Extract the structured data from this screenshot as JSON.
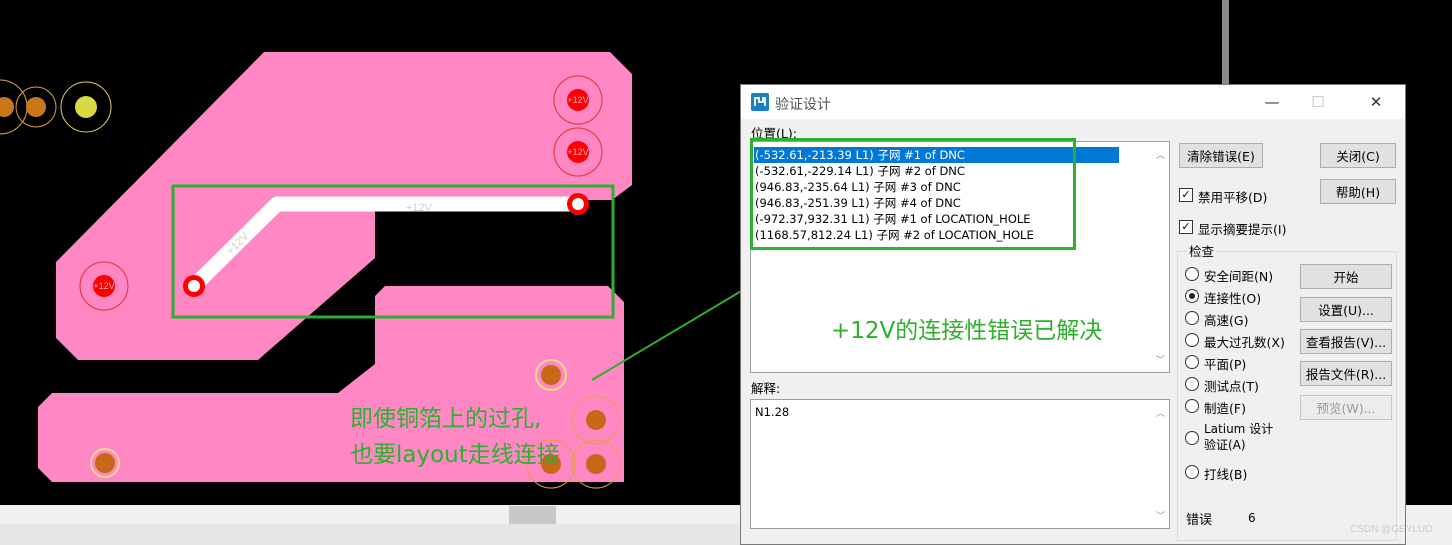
{
  "pcb": {
    "net_labels": [
      "+12V",
      "+12V",
      "+12V",
      "+12V",
      "+12V"
    ]
  },
  "dialog": {
    "title": "验证设计",
    "window_controls": {
      "minimize": "—",
      "maximize": "☐",
      "close": "✕"
    },
    "location_label": "位置(L):",
    "locations": [
      "(-532.61,-213.39 L1) 子网 #1 of DNC",
      "(-532.61,-229.14 L1) 子网 #2 of DNC",
      "(946.83,-235.64 L1) 子网 #3 of DNC",
      "(946.83,-251.39 L1) 子网 #4 of DNC",
      "(-972.37,932.31 L1) 子网 #1 of LOCATION_HOLE",
      "(1168.57,812.24 L1) 子网 #2 of LOCATION_HOLE"
    ],
    "explanation_label": "解释:",
    "explanation_text": "N1.28",
    "buttons": {
      "clear_errors": "清除错误(E)",
      "close": "关闭(C)",
      "help": "帮助(H)",
      "start": "开始",
      "settings": "设置(U)...",
      "view_report": "查看报告(V)...",
      "report_file": "报告文件(R)...",
      "preview": "预览(W)..."
    },
    "checkboxes": {
      "disable_pan": {
        "label": "禁用平移(D)",
        "checked": true
      },
      "show_hint": {
        "label": "显示摘要提示(I)",
        "checked": true
      }
    },
    "check_group_label": "检查",
    "check_options": [
      {
        "label": "安全间距(N)",
        "selected": false
      },
      {
        "label": "连接性(O)",
        "selected": true
      },
      {
        "label": "高速(G)",
        "selected": false
      },
      {
        "label": "最大过孔数(X)",
        "selected": false
      },
      {
        "label": "平面(P)",
        "selected": false
      },
      {
        "label": "测试点(T)",
        "selected": false
      },
      {
        "label": "制造(F)",
        "selected": false
      },
      {
        "label": "Latium 设计\n验证(A)",
        "selected": false
      },
      {
        "label": "打线(B)",
        "selected": false
      }
    ],
    "errors_label": "错误",
    "errors_count": "6"
  },
  "annotations": {
    "resolved_note": "+12V的连接性错误已解决",
    "via_note_line1": "即使铜箔上的过孔,",
    "via_note_line2": "也要layout走线连接"
  },
  "watermark": "CSDN @GEYLUO",
  "colors": {
    "background": "#000000",
    "copper_pour": "#ff88c4",
    "trace": "#ffffff",
    "via_red": "#ff0000",
    "annotation_green": "#2db02d",
    "selection": "#0078d7"
  }
}
